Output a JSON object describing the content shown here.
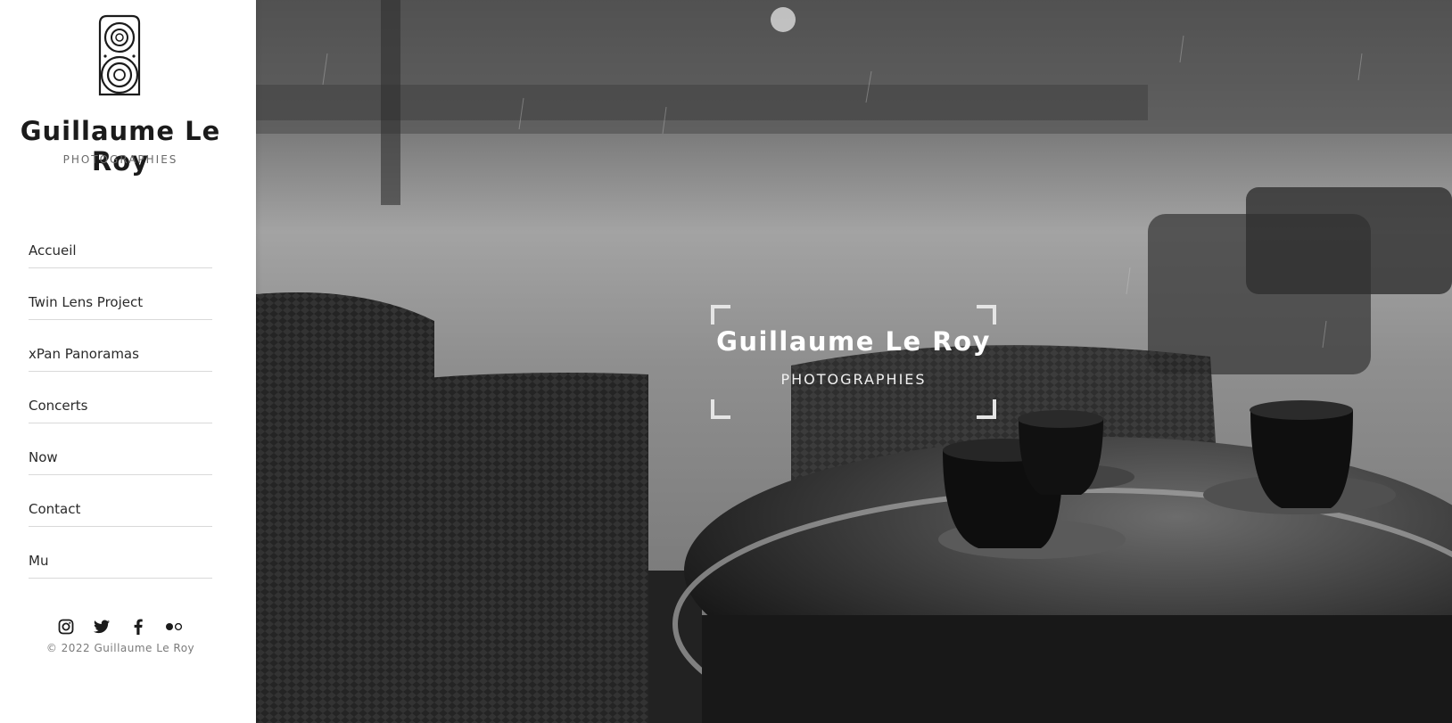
{
  "site": {
    "title": "Guillaume Le Roy",
    "subtitle": "PHOTOGRAPHIES",
    "logo_icon": "twin-lens-camera-icon"
  },
  "nav": {
    "items": [
      {
        "label": "Accueil"
      },
      {
        "label": "Twin Lens Project"
      },
      {
        "label": "xPan Panoramas"
      },
      {
        "label": "Concerts"
      },
      {
        "label": "Now"
      },
      {
        "label": "Contact"
      },
      {
        "label": "Mu"
      }
    ]
  },
  "social": {
    "icons": [
      "instagram-icon",
      "twitter-icon",
      "facebook-icon",
      "flickr-icon"
    ]
  },
  "footer": {
    "copyright": "© 2022 Guillaume Le Roy"
  },
  "hero": {
    "title": "Guillaume Le Roy",
    "subtitle": "PHOTOGRAPHIES"
  },
  "colors": {
    "text_dark": "#1b1b1b",
    "hero_overlay_text": "#ffffff",
    "divider": "#d9d9d9"
  }
}
